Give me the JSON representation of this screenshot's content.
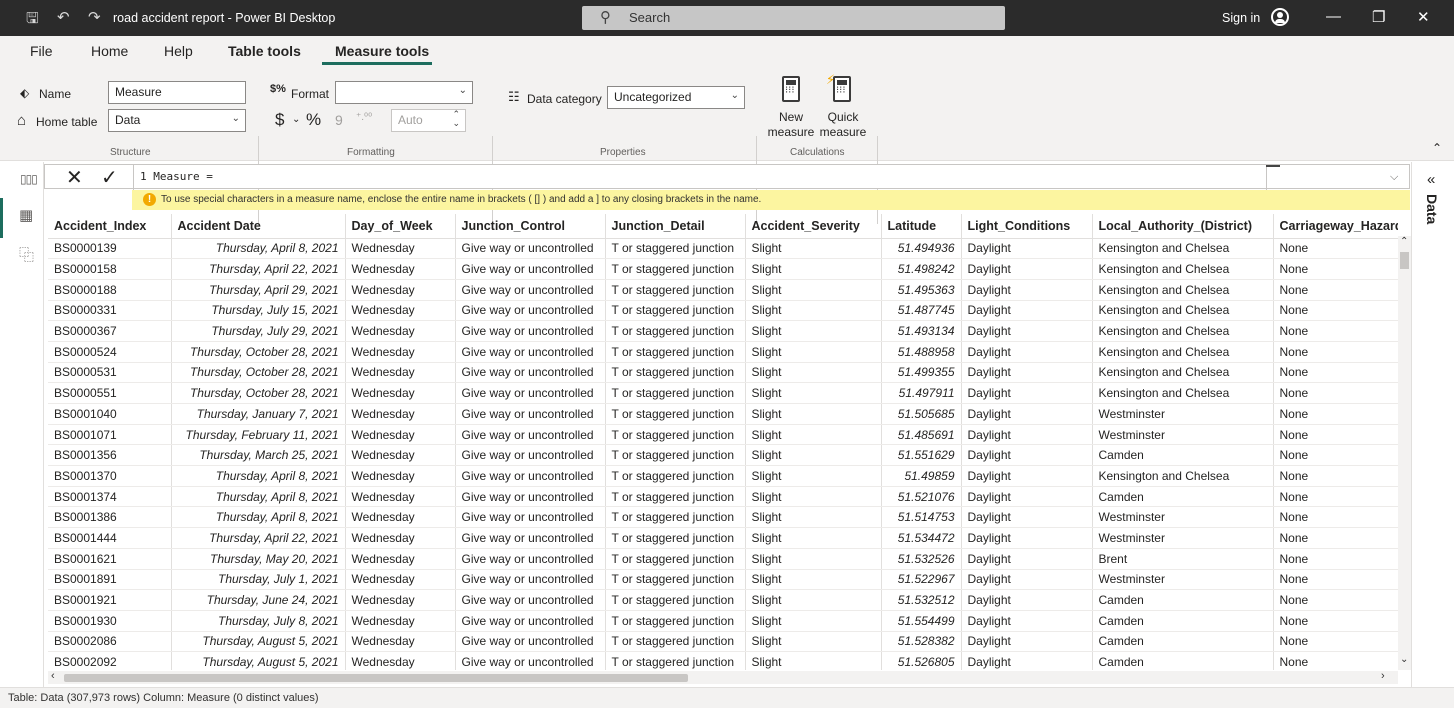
{
  "window": {
    "title": "road accident report - Power BI Desktop",
    "search_label": "Search",
    "signin_label": "Sign in"
  },
  "menu": {
    "items": [
      "File",
      "Home",
      "Help",
      "Table tools",
      "Measure tools"
    ],
    "active": "Measure tools"
  },
  "ribbon": {
    "name_label": "Name",
    "name_value": "Measure",
    "home_table_label": "Home table",
    "home_table_value": "Data",
    "structure_group": "Structure",
    "format_label": "Format",
    "format_value": "",
    "currency_symbol": "$",
    "percent_symbol": "%",
    "comma_symbol": "9",
    "decimal_value": "Auto",
    "formatting_group": "Formatting",
    "data_category_label": "Data category",
    "data_category_value": "Uncategorized",
    "properties_group": "Properties",
    "new_measure_line1": "New",
    "new_measure_line2": "measure",
    "quick_measure_line1": "Quick",
    "quick_measure_line2": "measure",
    "calculations_group": "Calculations"
  },
  "formula": {
    "text": "1  Measure =",
    "warning": "To use special characters in a measure name, enclose the entire name in brackets ( [] ) and add a ] to any closing brackets in the name."
  },
  "right_panel": {
    "label": "Data"
  },
  "table": {
    "columns": [
      "Accident_Index",
      "Accident Date",
      "Day_of_Week",
      "Junction_Control",
      "Junction_Detail",
      "Accident_Severity",
      "Latitude",
      "Light_Conditions",
      "Local_Authority_(District)",
      "Carriageway_Hazards"
    ],
    "rows": [
      [
        "BS0000139",
        "Thursday, April 8, 2021",
        "Wednesday",
        "Give way or uncontrolled",
        "T or staggered junction",
        "Slight",
        "51.494936",
        "Daylight",
        "Kensington and Chelsea",
        "None"
      ],
      [
        "BS0000158",
        "Thursday, April 22, 2021",
        "Wednesday",
        "Give way or uncontrolled",
        "T or staggered junction",
        "Slight",
        "51.498242",
        "Daylight",
        "Kensington and Chelsea",
        "None"
      ],
      [
        "BS0000188",
        "Thursday, April 29, 2021",
        "Wednesday",
        "Give way or uncontrolled",
        "T or staggered junction",
        "Slight",
        "51.495363",
        "Daylight",
        "Kensington and Chelsea",
        "None"
      ],
      [
        "BS0000331",
        "Thursday, July 15, 2021",
        "Wednesday",
        "Give way or uncontrolled",
        "T or staggered junction",
        "Slight",
        "51.487745",
        "Daylight",
        "Kensington and Chelsea",
        "None"
      ],
      [
        "BS0000367",
        "Thursday, July 29, 2021",
        "Wednesday",
        "Give way or uncontrolled",
        "T or staggered junction",
        "Slight",
        "51.493134",
        "Daylight",
        "Kensington and Chelsea",
        "None"
      ],
      [
        "BS0000524",
        "Thursday, October 28, 2021",
        "Wednesday",
        "Give way or uncontrolled",
        "T or staggered junction",
        "Slight",
        "51.488958",
        "Daylight",
        "Kensington and Chelsea",
        "None"
      ],
      [
        "BS0000531",
        "Thursday, October 28, 2021",
        "Wednesday",
        "Give way or uncontrolled",
        "T or staggered junction",
        "Slight",
        "51.499355",
        "Daylight",
        "Kensington and Chelsea",
        "None"
      ],
      [
        "BS0000551",
        "Thursday, October 28, 2021",
        "Wednesday",
        "Give way or uncontrolled",
        "T or staggered junction",
        "Slight",
        "51.497911",
        "Daylight",
        "Kensington and Chelsea",
        "None"
      ],
      [
        "BS0001040",
        "Thursday, January 7, 2021",
        "Wednesday",
        "Give way or uncontrolled",
        "T or staggered junction",
        "Slight",
        "51.505685",
        "Daylight",
        "Westminster",
        "None"
      ],
      [
        "BS0001071",
        "Thursday, February 11, 2021",
        "Wednesday",
        "Give way or uncontrolled",
        "T or staggered junction",
        "Slight",
        "51.485691",
        "Daylight",
        "Westminster",
        "None"
      ],
      [
        "BS0001356",
        "Thursday, March 25, 2021",
        "Wednesday",
        "Give way or uncontrolled",
        "T or staggered junction",
        "Slight",
        "51.551629",
        "Daylight",
        "Camden",
        "None"
      ],
      [
        "BS0001370",
        "Thursday, April 8, 2021",
        "Wednesday",
        "Give way or uncontrolled",
        "T or staggered junction",
        "Slight",
        "51.49859",
        "Daylight",
        "Kensington and Chelsea",
        "None"
      ],
      [
        "BS0001374",
        "Thursday, April 8, 2021",
        "Wednesday",
        "Give way or uncontrolled",
        "T or staggered junction",
        "Slight",
        "51.521076",
        "Daylight",
        "Camden",
        "None"
      ],
      [
        "BS0001386",
        "Thursday, April 8, 2021",
        "Wednesday",
        "Give way or uncontrolled",
        "T or staggered junction",
        "Slight",
        "51.514753",
        "Daylight",
        "Westminster",
        "None"
      ],
      [
        "BS0001444",
        "Thursday, April 22, 2021",
        "Wednesday",
        "Give way or uncontrolled",
        "T or staggered junction",
        "Slight",
        "51.534472",
        "Daylight",
        "Westminster",
        "None"
      ],
      [
        "BS0001621",
        "Thursday, May 20, 2021",
        "Wednesday",
        "Give way or uncontrolled",
        "T or staggered junction",
        "Slight",
        "51.532526",
        "Daylight",
        "Brent",
        "None"
      ],
      [
        "BS0001891",
        "Thursday, July 1, 2021",
        "Wednesday",
        "Give way or uncontrolled",
        "T or staggered junction",
        "Slight",
        "51.522967",
        "Daylight",
        "Westminster",
        "None"
      ],
      [
        "BS0001921",
        "Thursday, June 24, 2021",
        "Wednesday",
        "Give way or uncontrolled",
        "T or staggered junction",
        "Slight",
        "51.532512",
        "Daylight",
        "Camden",
        "None"
      ],
      [
        "BS0001930",
        "Thursday, July 8, 2021",
        "Wednesday",
        "Give way or uncontrolled",
        "T or staggered junction",
        "Slight",
        "51.554499",
        "Daylight",
        "Camden",
        "None"
      ],
      [
        "BS0002086",
        "Thursday, August 5, 2021",
        "Wednesday",
        "Give way or uncontrolled",
        "T or staggered junction",
        "Slight",
        "51.528382",
        "Daylight",
        "Camden",
        "None"
      ],
      [
        "BS0002092",
        "Thursday, August 5, 2021",
        "Wednesday",
        "Give way or uncontrolled",
        "T or staggered junction",
        "Slight",
        "51.526805",
        "Daylight",
        "Camden",
        "None"
      ]
    ]
  },
  "status": {
    "text": "Table: Data (307,973 rows) Column: Measure (0 distinct values)"
  },
  "colors": {
    "accent": "#1d6d5e",
    "titlebar": "#2b2b2b",
    "warning_bg": "#fcf5a0"
  }
}
